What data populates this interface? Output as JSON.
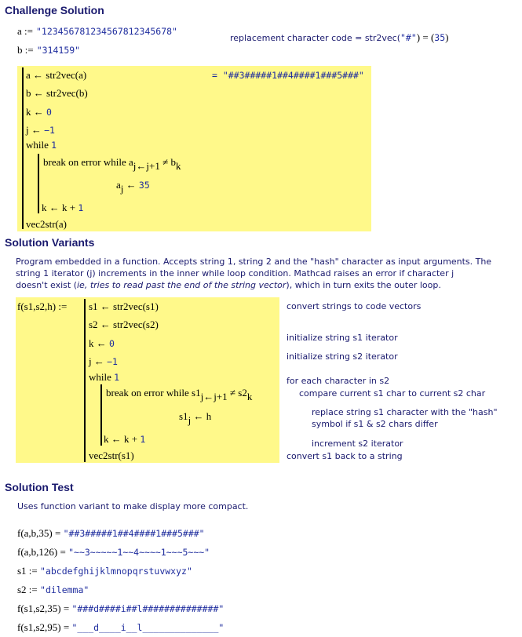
{
  "challenge": {
    "heading": "Challenge Solution",
    "def_a": {
      "lhs": "a :=",
      "value": "\"123456781234567812345678\""
    },
    "def_b": {
      "lhs": "b :=",
      "value": "\"314159\""
    },
    "replacement_note": {
      "label": "replacement character code = str2vec(",
      "arg": "\"#\"",
      "mid": ") = (",
      "value": "35",
      "end": ")"
    },
    "program": {
      "lines": [
        "a ← str2vec(a)",
        "b ← str2vec(b)",
        "k ← ",
        "j ← ",
        "while "
      ],
      "k_init": "0",
      "j_init": "−1",
      "while_cond": "1",
      "inner_break": "break   on error while  a",
      "inner_sub": "j←j+1",
      "inner_neq": " ≠ b",
      "inner_sub_k": "k",
      "assign_lhs": "a",
      "assign_sub": "j",
      "assign_rhs": " ← ",
      "assign_val": "35",
      "incr": "k ← k + ",
      "incr_val": "1",
      "ret": "vec2str(a)",
      "result": "= \"##3#####1##4####1###5###\""
    }
  },
  "variants": {
    "heading": "Solution Variants",
    "paragraph_1": "Program embedded in a function.  Accepts string 1, string 2 and the \"hash\" character as input arguments.   The",
    "paragraph_2": "string 1 iterator (j) increments in the inner while loop condition.  Mathcad raises an error if character j",
    "paragraph_3a": "doesn't exist (",
    "paragraph_3i": "ie, tries to read past the end of the string vector",
    "paragraph_3b": "), which in turn exits the outer loop.",
    "func_def": "f(s1,s2,h) :=",
    "program": {
      "l1": "s1 ← str2vec(s1)",
      "l2": "s2 ← str2vec(s2)",
      "l3": "k ← ",
      "k_init": "0",
      "l4": "j ← ",
      "j_init": "−1",
      "l5": "while ",
      "while_cond": "1",
      "inner_break": "break   on error while  s1",
      "inner_sub": "j←j+1",
      "inner_neq": " ≠ s2",
      "inner_sub_k": "k",
      "assign_lhs": "s1",
      "assign_sub": "j",
      "assign_rhs": " ← h",
      "incr": "k ← k + ",
      "incr_val": "1",
      "ret": "vec2str(s1)"
    },
    "comments": [
      "convert strings to code vectors",
      "initialize string s1 iterator",
      "initialize string s2 iterator",
      "for each character in s2",
      "compare current s1 char to current s2 char",
      "replace string s1 character with the \"hash\"",
      "symbol if s1 & s2 chars differ",
      "increment s2 iterator",
      "convert s1 back to a string"
    ]
  },
  "test": {
    "heading": "Solution Test",
    "note": "Uses function variant to make display more compact.",
    "rows": [
      {
        "lhs": "f(a,b,35) = ",
        "value": "\"##3#####1##4####1###5###\""
      },
      {
        "lhs": "f(a,b,126) = ",
        "value": "\"~~3~~~~~1~~4~~~~1~~~5~~~\""
      },
      {
        "lhs": "s1 := ",
        "value": "\"abcdefghijklmnopqrstuvwxyz\""
      },
      {
        "lhs": "s2 := ",
        "value": "\"dilemma\""
      },
      {
        "lhs": "f(s1,s2,35) = ",
        "value": "\"###d####i##l##############\""
      },
      {
        "lhs": "f(s1,s2,95) = ",
        "value": "\"___d____i__l______________\""
      }
    ]
  }
}
